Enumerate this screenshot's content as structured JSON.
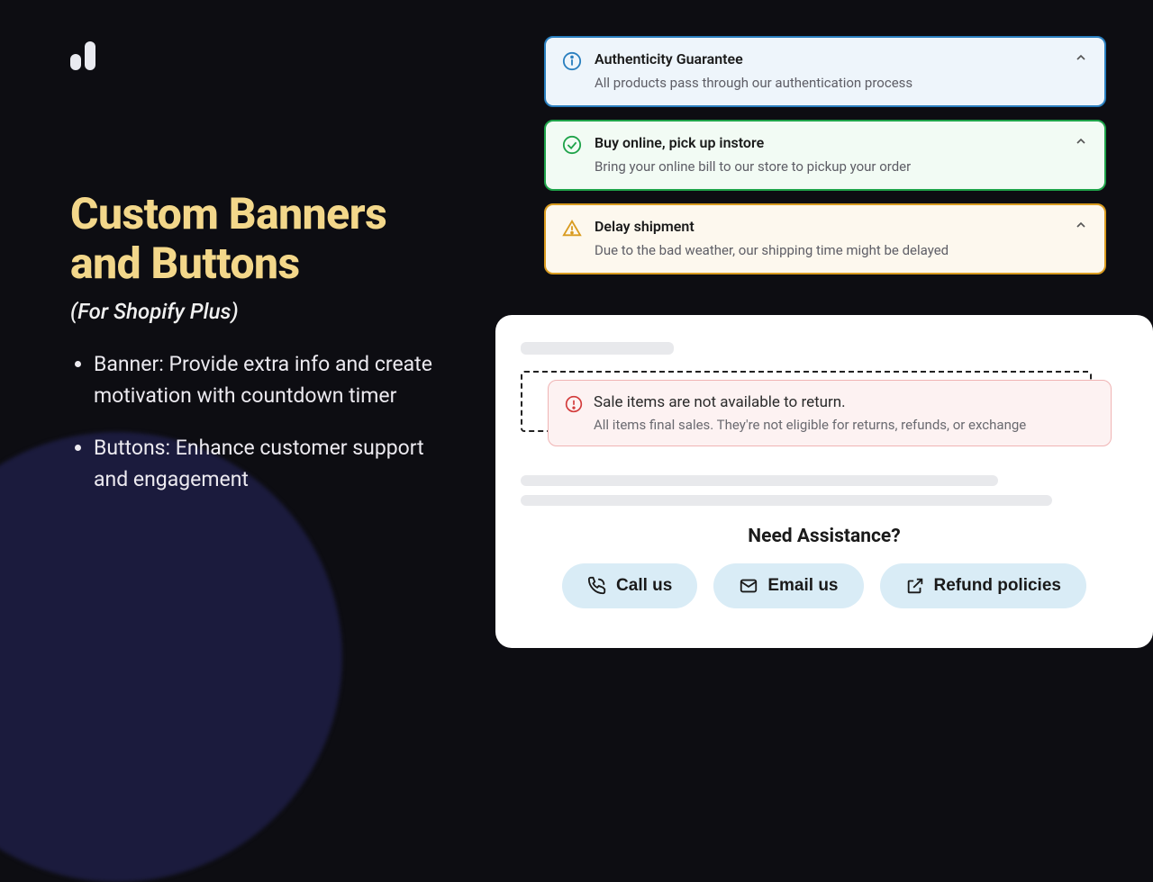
{
  "left": {
    "heading": "Custom Banners and Buttons",
    "subtitle": "(For Shopify Plus)",
    "bullets": [
      "Banner: Provide extra info and create motivation with countdown timer",
      "Buttons: Enhance customer support and engagement"
    ]
  },
  "banners": [
    {
      "icon": "info",
      "title": "Authenticity Guarantee",
      "desc": "All products pass through our authentication process"
    },
    {
      "icon": "check",
      "title": "Buy online, pick up instore",
      "desc": "Bring your online bill to our store to pickup your order"
    },
    {
      "icon": "warning",
      "title": "Delay shipment",
      "desc": "Due to the bad weather, our shipping time might be delayed"
    }
  ],
  "panel": {
    "error": {
      "title": "Sale items are not available to return.",
      "desc": "All items final sales. They're not eligible for returns, refunds, or exchange"
    },
    "assist_heading": "Need Assistance?",
    "buttons": [
      {
        "icon": "phone",
        "label": "Call us"
      },
      {
        "icon": "mail",
        "label": "Email us"
      },
      {
        "icon": "external",
        "label": "Refund policies"
      }
    ]
  }
}
